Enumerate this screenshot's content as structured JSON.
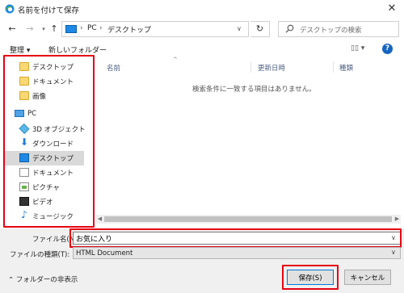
{
  "window": {
    "title": "名前を付けて保存"
  },
  "address": {
    "root": "PC",
    "location": "デスクトップ",
    "separator": "›"
  },
  "search": {
    "placeholder": "デスクトップの検索"
  },
  "toolbar": {
    "organize": "整理 ▾",
    "new_folder": "新しいフォルダー",
    "view": "▯▯ ▾",
    "help": "?"
  },
  "nav": {
    "items": [
      {
        "label": "デスクトップ",
        "icon": "folder-icon"
      },
      {
        "label": "ドキュメント",
        "icon": "folder-icon"
      },
      {
        "label": "画像",
        "icon": "folder-icon"
      },
      {
        "label": "PC",
        "icon": "computer-icon"
      },
      {
        "label": "3D オブジェクト",
        "icon": "3d-objects-icon"
      },
      {
        "label": "ダウンロード",
        "icon": "download-icon"
      },
      {
        "label": "デスクトップ",
        "icon": "desktop-icon"
      },
      {
        "label": "ドキュメント",
        "icon": "document-icon"
      },
      {
        "label": "ピクチャ",
        "icon": "pictures-icon"
      },
      {
        "label": "ビデオ",
        "icon": "video-icon"
      },
      {
        "label": "ミュージック",
        "icon": "music-icon"
      }
    ]
  },
  "filelist": {
    "columns": {
      "name": "名前",
      "date": "更新日時",
      "type": "種類"
    },
    "sort_arrow": "^",
    "empty_message": "検索条件に一致する項目はありません。"
  },
  "form": {
    "filename_label": "ファイル名(N):",
    "filename_value": "お気に入り",
    "filetype_label": "ファイルの種類(T):",
    "filetype_value": "HTML Document"
  },
  "footer": {
    "hide_folders": "フォルダーの非表示",
    "save": "保存(S)",
    "cancel": "キャンセル"
  },
  "colors": {
    "highlight": "#e60012",
    "accent": "#0078d7"
  }
}
